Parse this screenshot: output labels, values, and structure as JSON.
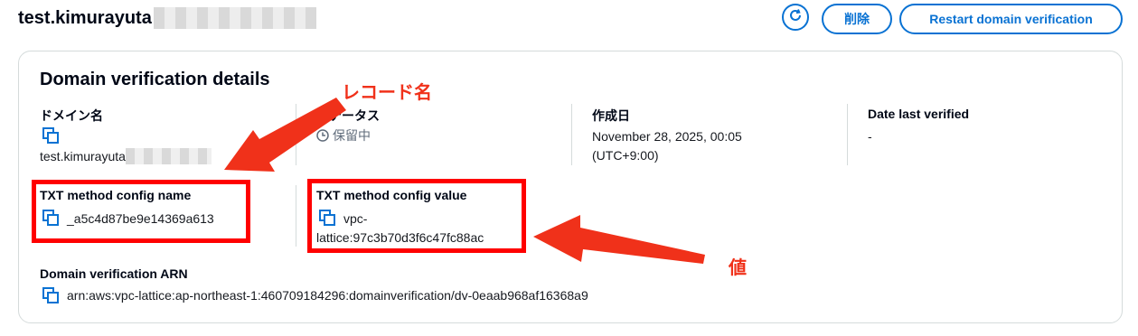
{
  "header": {
    "title": "test.kimurayuta",
    "delete_label": "削除",
    "restart_label": "Restart domain verification"
  },
  "panel": {
    "title": "Domain verification details",
    "domain_name_label": "ドメイン名",
    "domain_name_value": "test.kimurayuta",
    "status_label": "ステータス",
    "status_value": "保留中",
    "created_label": "作成日",
    "created_value_line1": "November 28, 2025, 00:05",
    "created_value_line2": "(UTC+9:00)",
    "last_verified_label": "Date last verified",
    "last_verified_value": "-",
    "txt_name_label": "TXT method config name",
    "txt_name_value": "_a5c4d87be9e14369a613",
    "txt_value_label": "TXT method config value",
    "txt_value_line1": "vpc-",
    "txt_value_line2": "lattice:97c3b70d3f6c47fc88ac",
    "arn_label": "Domain verification ARN",
    "arn_value": "arn:aws:vpc-lattice:ap-northeast-1:460709184296:domainverification/dv-0eaab968af16368a9"
  },
  "annotations": {
    "record_name": "レコード名",
    "value": "値"
  },
  "colors": {
    "accent": "#0972d3",
    "annotation": "#f0311a"
  },
  "icons": [
    "refresh-icon",
    "copy-icon",
    "clock-icon"
  ]
}
